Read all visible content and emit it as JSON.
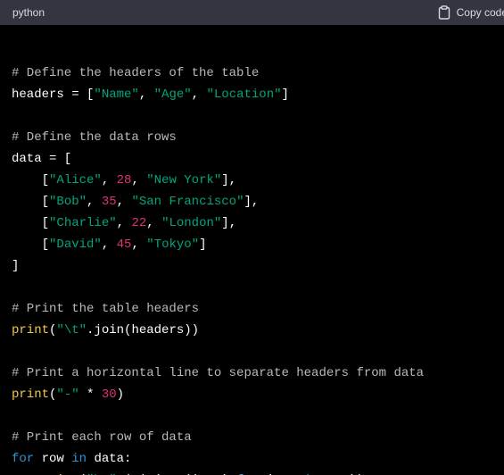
{
  "header": {
    "language": "python",
    "copy_label": "Copy code",
    "copy_icon": "clipboard-icon"
  },
  "colors": {
    "header_bg": "#343541",
    "code_bg": "#000000",
    "plain": "#ffffff",
    "comment": "#b9b9b9",
    "string": "#00a67d",
    "number": "#df3079",
    "builtin": "#f2c94c",
    "keyword": "#2e95d3"
  },
  "code": {
    "lines": [
      [],
      [
        {
          "t": "comment",
          "v": "# Define the headers of the table"
        }
      ],
      [
        {
          "t": "plain",
          "v": "headers = ["
        },
        {
          "t": "string",
          "v": "\"Name\""
        },
        {
          "t": "plain",
          "v": ", "
        },
        {
          "t": "string",
          "v": "\"Age\""
        },
        {
          "t": "plain",
          "v": ", "
        },
        {
          "t": "string",
          "v": "\"Location\""
        },
        {
          "t": "plain",
          "v": "]"
        }
      ],
      [],
      [
        {
          "t": "comment",
          "v": "# Define the data rows"
        }
      ],
      [
        {
          "t": "plain",
          "v": "data = ["
        }
      ],
      [
        {
          "t": "plain",
          "v": "    ["
        },
        {
          "t": "string",
          "v": "\"Alice\""
        },
        {
          "t": "plain",
          "v": ", "
        },
        {
          "t": "number",
          "v": "28"
        },
        {
          "t": "plain",
          "v": ", "
        },
        {
          "t": "string",
          "v": "\"New York\""
        },
        {
          "t": "plain",
          "v": "],"
        }
      ],
      [
        {
          "t": "plain",
          "v": "    ["
        },
        {
          "t": "string",
          "v": "\"Bob\""
        },
        {
          "t": "plain",
          "v": ", "
        },
        {
          "t": "number",
          "v": "35"
        },
        {
          "t": "plain",
          "v": ", "
        },
        {
          "t": "string",
          "v": "\"San Francisco\""
        },
        {
          "t": "plain",
          "v": "],"
        }
      ],
      [
        {
          "t": "plain",
          "v": "    ["
        },
        {
          "t": "string",
          "v": "\"Charlie\""
        },
        {
          "t": "plain",
          "v": ", "
        },
        {
          "t": "number",
          "v": "22"
        },
        {
          "t": "plain",
          "v": ", "
        },
        {
          "t": "string",
          "v": "\"London\""
        },
        {
          "t": "plain",
          "v": "],"
        }
      ],
      [
        {
          "t": "plain",
          "v": "    ["
        },
        {
          "t": "string",
          "v": "\"David\""
        },
        {
          "t": "plain",
          "v": ", "
        },
        {
          "t": "number",
          "v": "45"
        },
        {
          "t": "plain",
          "v": ", "
        },
        {
          "t": "string",
          "v": "\"Tokyo\""
        },
        {
          "t": "plain",
          "v": "]"
        }
      ],
      [
        {
          "t": "plain",
          "v": "]"
        }
      ],
      [],
      [
        {
          "t": "comment",
          "v": "# Print the table headers"
        }
      ],
      [
        {
          "t": "builtin",
          "v": "print"
        },
        {
          "t": "plain",
          "v": "("
        },
        {
          "t": "string",
          "v": "\"\\t\""
        },
        {
          "t": "plain",
          "v": ".join(headers))"
        }
      ],
      [],
      [
        {
          "t": "comment",
          "v": "# Print a horizontal line to separate headers from data"
        }
      ],
      [
        {
          "t": "builtin",
          "v": "print"
        },
        {
          "t": "plain",
          "v": "("
        },
        {
          "t": "string",
          "v": "\"-\""
        },
        {
          "t": "plain",
          "v": " * "
        },
        {
          "t": "number",
          "v": "30"
        },
        {
          "t": "plain",
          "v": ")"
        }
      ],
      [],
      [
        {
          "t": "comment",
          "v": "# Print each row of data"
        }
      ],
      [
        {
          "t": "keyword",
          "v": "for"
        },
        {
          "t": "plain",
          "v": " row "
        },
        {
          "t": "keyword",
          "v": "in"
        },
        {
          "t": "plain",
          "v": " data:"
        }
      ],
      [
        {
          "t": "plain",
          "v": "    "
        },
        {
          "t": "builtin",
          "v": "print"
        },
        {
          "t": "plain",
          "v": "("
        },
        {
          "t": "string",
          "v": "\"\\t\""
        },
        {
          "t": "plain",
          "v": ".join("
        },
        {
          "t": "builtin",
          "v": "str"
        },
        {
          "t": "plain",
          "v": "(item) "
        },
        {
          "t": "keyword",
          "v": "for"
        },
        {
          "t": "plain",
          "v": " item "
        },
        {
          "t": "keyword",
          "v": "in"
        },
        {
          "t": "plain",
          "v": " row))"
        }
      ]
    ]
  }
}
